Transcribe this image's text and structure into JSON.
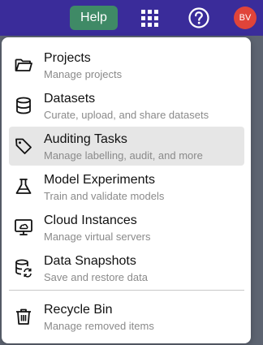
{
  "topbar": {
    "help_label": "Help",
    "avatar_initials": "BV",
    "colors": {
      "bar": "#3a2c9a",
      "help": "#3f8a66",
      "avatar": "#e0443a"
    }
  },
  "menu": {
    "items": [
      {
        "title": "Projects",
        "subtitle": "Manage projects",
        "icon": "folder-icon"
      },
      {
        "title": "Datasets",
        "subtitle": "Curate, upload, and share datasets",
        "icon": "database-icon"
      },
      {
        "title": "Auditing Tasks",
        "subtitle": "Manage labelling, audit, and more",
        "icon": "tag-icon",
        "active": true
      },
      {
        "title": "Model Experiments",
        "subtitle": "Train and validate models",
        "icon": "flask-icon"
      },
      {
        "title": "Cloud Instances",
        "subtitle": "Manage virtual servers",
        "icon": "cloud-monitor-icon"
      },
      {
        "title": "Data Snapshots",
        "subtitle": "Save and restore data",
        "icon": "database-sync-icon"
      }
    ],
    "footer_item": {
      "title": "Recycle Bin",
      "subtitle": "Manage removed items",
      "icon": "trash-icon"
    }
  }
}
